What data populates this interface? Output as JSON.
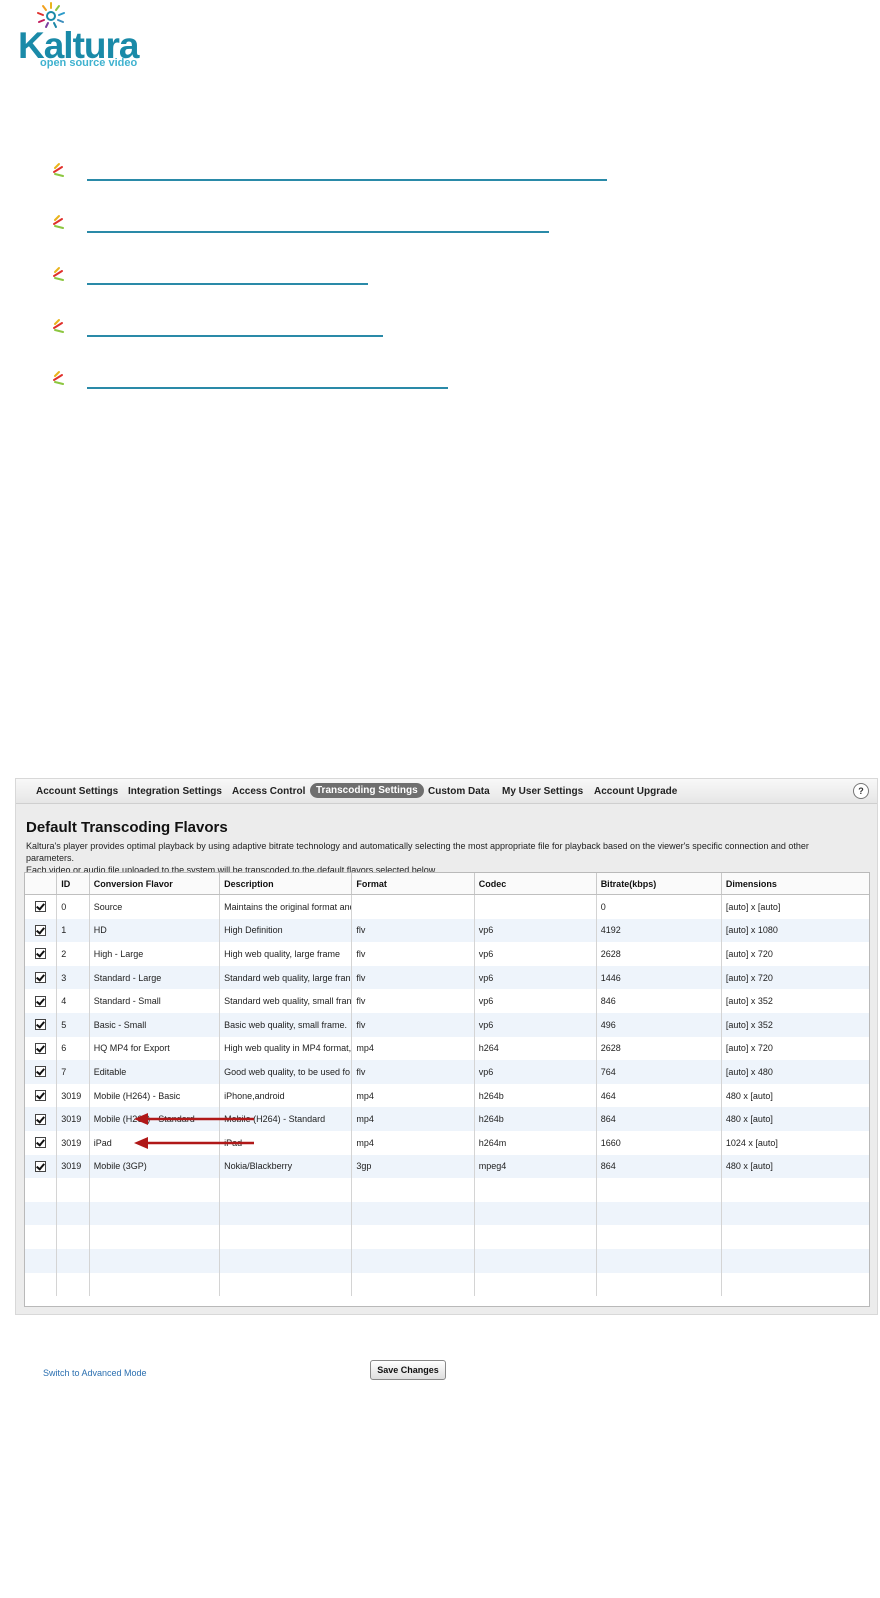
{
  "logo": {
    "name": "Kaltura",
    "tagline": "open source video",
    "colors": {
      "word": "#1a8aa8",
      "tagline": "#3fb2cf"
    }
  },
  "links": [
    {
      "text": "",
      "width": 520
    },
    {
      "text": "",
      "width": 462
    },
    {
      "text": "",
      "width": 281
    },
    {
      "text": "",
      "width": 296
    },
    {
      "text": "",
      "width": 361
    }
  ],
  "tabs": [
    {
      "label": "Account Settings",
      "active": false
    },
    {
      "label": "Integration Settings",
      "active": false
    },
    {
      "label": "Access Control",
      "active": false
    },
    {
      "label": "Transcoding Settings",
      "active": true
    },
    {
      "label": "Custom Data",
      "active": false
    },
    {
      "label": "My User Settings",
      "active": false
    },
    {
      "label": "Account Upgrade",
      "active": false
    }
  ],
  "help_label": "?",
  "section": {
    "title": "Default Transcoding Flavors",
    "description_line1": "Kaltura's player provides optimal playback by using adaptive bitrate technology and automatically selecting the most appropriate file for playback based on the viewer's specific connection and other parameters.",
    "description_line2": "Each video or audio file uploaded to the system will be transcoded to the default flavors selected below."
  },
  "table": {
    "headers": [
      "",
      "ID",
      "Conversion Flavor",
      "Description",
      "Format",
      "Codec",
      "Bitrate(kbps)",
      "Dimensions"
    ],
    "rows": [
      {
        "checked": true,
        "id": "0",
        "flavor": "Source",
        "description": "Maintains the original format and",
        "format": "",
        "codec": "",
        "bitrate": "0",
        "dimensions": "[auto] x [auto]"
      },
      {
        "checked": true,
        "id": "1",
        "flavor": "HD",
        "description": "High Definition",
        "format": "flv",
        "codec": "vp6",
        "bitrate": "4192",
        "dimensions": "[auto] x 1080"
      },
      {
        "checked": true,
        "id": "2",
        "flavor": "High - Large",
        "description": "High web quality, large frame",
        "format": "flv",
        "codec": "vp6",
        "bitrate": "2628",
        "dimensions": "[auto] x 720"
      },
      {
        "checked": true,
        "id": "3",
        "flavor": "Standard - Large",
        "description": "Standard web quality, large fran",
        "format": "flv",
        "codec": "vp6",
        "bitrate": "1446",
        "dimensions": "[auto] x 720"
      },
      {
        "checked": true,
        "id": "4",
        "flavor": "Standard - Small",
        "description": "Standard web quality, small fran",
        "format": "flv",
        "codec": "vp6",
        "bitrate": "846",
        "dimensions": "[auto] x 352"
      },
      {
        "checked": true,
        "id": "5",
        "flavor": "Basic - Small",
        "description": "Basic web quality, small frame.",
        "format": "flv",
        "codec": "vp6",
        "bitrate": "496",
        "dimensions": "[auto] x 352"
      },
      {
        "checked": true,
        "id": "6",
        "flavor": "HQ MP4 for Export",
        "description": "High web quality in MP4 format,",
        "format": "mp4",
        "codec": "h264",
        "bitrate": "2628",
        "dimensions": "[auto] x 720"
      },
      {
        "checked": true,
        "id": "7",
        "flavor": "Editable",
        "description": "Good web quality, to be used fo",
        "format": "flv",
        "codec": "vp6",
        "bitrate": "764",
        "dimensions": "[auto] x 480"
      },
      {
        "checked": true,
        "id": "3019",
        "flavor": "Mobile (H264) - Basic",
        "description": "iPhone,android",
        "format": "mp4",
        "codec": "h264b",
        "bitrate": "464",
        "dimensions": "480 x [auto]"
      },
      {
        "checked": true,
        "id": "3019",
        "flavor": "Mobile (H264) - Standard",
        "description": "Mobile (H264) - Standard",
        "format": "mp4",
        "codec": "h264b",
        "bitrate": "864",
        "dimensions": "480 x [auto]"
      },
      {
        "checked": true,
        "id": "3019",
        "flavor": "iPad",
        "description": "iPad",
        "format": "mp4",
        "codec": "h264m",
        "bitrate": "1660",
        "dimensions": "1024 x [auto]"
      },
      {
        "checked": true,
        "id": "3019",
        "flavor": "Mobile (3GP)",
        "description": "Nokia/Blackberry",
        "format": "3gp",
        "codec": "mpeg4",
        "bitrate": "864",
        "dimensions": "480 x [auto]"
      }
    ],
    "empty_rows": 5
  },
  "footer": {
    "advanced_link": "Switch to Advanced Mode",
    "save_label": "Save Changes"
  },
  "colors": {
    "accent": "#2a8aa8",
    "arrow": "#b01818",
    "tab_active": "#6f6f6f",
    "row_alt": "#eef4fb"
  }
}
